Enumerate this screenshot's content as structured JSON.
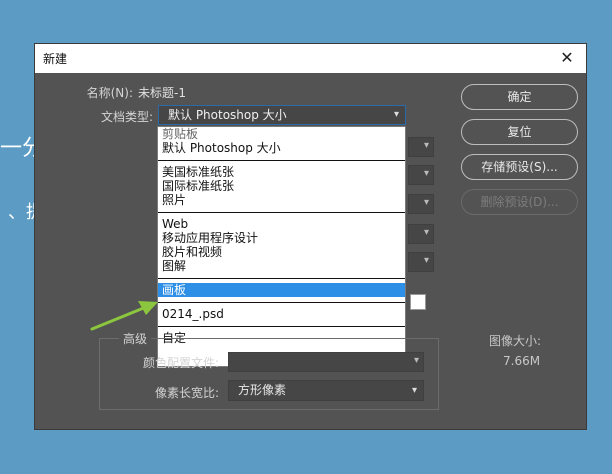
{
  "background": {
    "text_a": "一分",
    "text_b": "、提"
  },
  "dialog": {
    "title": "新建",
    "name_label": "名称(N):",
    "name_value": "未标题-1",
    "doc_type_label": "文档类型:",
    "doc_type_value": "默认 Photoshop 大小",
    "dropdown_groups": [
      [
        "剪贴板",
        "默认 Photoshop 大小"
      ],
      [
        "美国标准纸张",
        "国际标准纸张",
        "照片"
      ],
      [
        "Web",
        "移动应用程序设计",
        "胶片和视频",
        "图解"
      ],
      [
        "画板"
      ],
      [
        "0214_.psd"
      ],
      [
        "自定"
      ]
    ],
    "selected_option": "画板",
    "buttons": {
      "ok": "确定",
      "reset": "复位",
      "save_preset": "存储预设(S)...",
      "delete_preset": "删除预设(D)..."
    },
    "image_size_label": "图像大小:",
    "image_size_value": "7.66M",
    "advanced_label": "高级",
    "color_profile_label": "颜色配置文件:",
    "pixel_aspect_label": "像素长宽比:",
    "pixel_aspect_value": "方形像素"
  },
  "colors": {
    "accent": "#2e8fe6",
    "arrow": "#8cc63f",
    "dialog_bg": "#535353"
  }
}
